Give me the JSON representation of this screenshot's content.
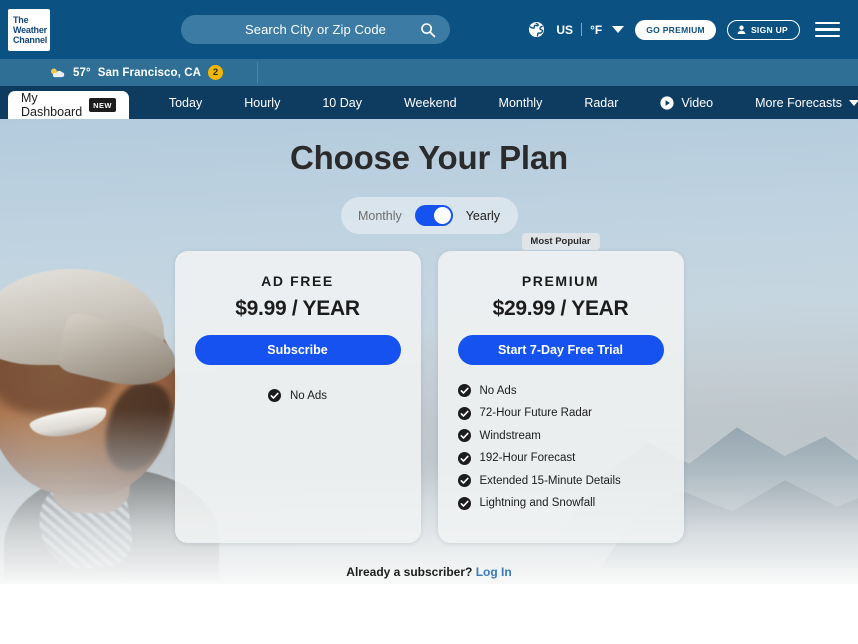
{
  "header": {
    "logo": {
      "line1": "The",
      "line2": "Weather",
      "line3": "Channel",
      "alt": "The Weather Channel"
    },
    "search": {
      "placeholder": "Search City or Zip Code",
      "value": "",
      "icon": "search-icon"
    },
    "region": "US",
    "unit": "°F",
    "globe_icon": "globe-icon",
    "region_caret_icon": "chevron-down-icon",
    "go_premium_label": "GO PREMIUM",
    "sign_up_label": "SIGN UP",
    "sign_up_icon": "person-icon",
    "menu_icon": "hamburger-menu-icon"
  },
  "location_bar": {
    "weather_icon": "partly-cloudy-icon",
    "temperature": "57°",
    "city": "San Francisco, CA",
    "alert_badge": "2"
  },
  "nav": {
    "active_tab": {
      "label": "My Dashboard",
      "badge": "NEW"
    },
    "items": [
      {
        "label": "Today",
        "icon": null
      },
      {
        "label": "Hourly",
        "icon": null
      },
      {
        "label": "10 Day",
        "icon": null
      },
      {
        "label": "Weekend",
        "icon": null
      },
      {
        "label": "Monthly",
        "icon": null
      },
      {
        "label": "Radar",
        "icon": null
      },
      {
        "label": "Video",
        "icon": "play-icon"
      },
      {
        "label": "More Forecasts",
        "icon": "chevron-down-icon"
      }
    ]
  },
  "hero": {
    "title": "Choose Your Plan",
    "billing_toggle": {
      "left_label": "Monthly",
      "right_label": "Yearly",
      "selected": "Yearly"
    },
    "most_popular_badge": "Most Popular",
    "plans": [
      {
        "name": "AD FREE",
        "price": "$9.99 / YEAR",
        "cta": "Subscribe",
        "most_popular": false,
        "features": [
          "No Ads"
        ]
      },
      {
        "name": "PREMIUM",
        "price": "$29.99 / YEAR",
        "cta": "Start 7-Day Free Trial",
        "most_popular": true,
        "features": [
          "No Ads",
          "72-Hour Future Radar",
          "Windstream",
          "192-Hour Forecast",
          "Extended 15-Minute Details",
          "Lightning and Snowfall"
        ]
      }
    ],
    "footer": {
      "prompt": "Already a subscriber?",
      "login_label": "Log In"
    }
  },
  "colors": {
    "header_blue": "#0b5283",
    "location_blue": "#2f6f96",
    "nav_blue": "#0e3c61",
    "search_pill": "#3b7ba4",
    "accent_blue": "#1652f0",
    "link_blue": "#3a7bbf",
    "badge_yellow": "#f2b705",
    "card_bg": "#f0f2f3"
  }
}
